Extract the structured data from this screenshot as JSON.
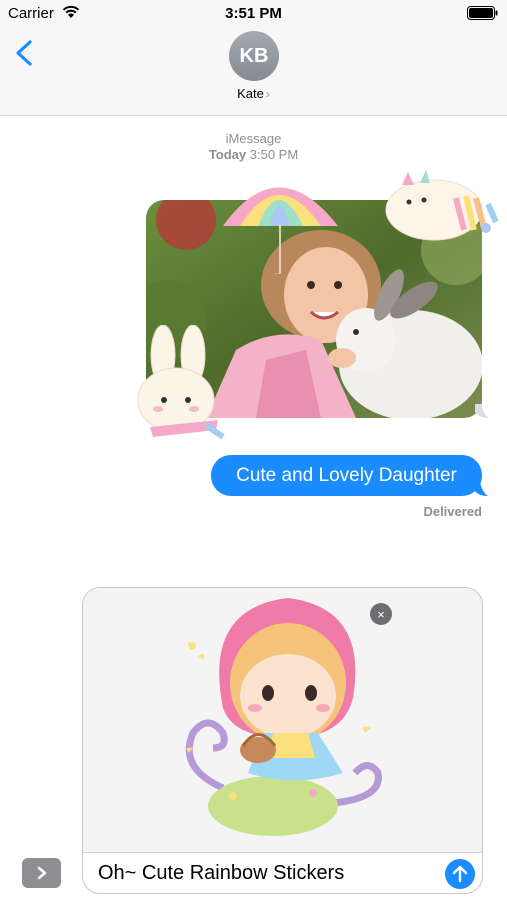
{
  "status_bar": {
    "carrier": "Carrier",
    "time": "3:51 PM",
    "battery_level": 1.0
  },
  "header": {
    "avatar_initials": "KB",
    "contact_name": "Kate",
    "contact_chevron": "›"
  },
  "conversation": {
    "service": "iMessage",
    "timestamp_day": "Today",
    "timestamp_time": "3:50 PM",
    "messages": [
      {
        "type": "photo",
        "description_icon": "girl-with-rabbit-photo"
      },
      {
        "type": "text",
        "text": "Cute and Lovely Daughter"
      }
    ],
    "delivery_status": "Delivered"
  },
  "compose": {
    "message_text": "Oh~ Cute Rainbow Stickers",
    "remove_icon": "×"
  },
  "colors": {
    "accent": "#1a8cff",
    "bubble_text": "#ffffff",
    "meta_text": "#8e8e93"
  }
}
